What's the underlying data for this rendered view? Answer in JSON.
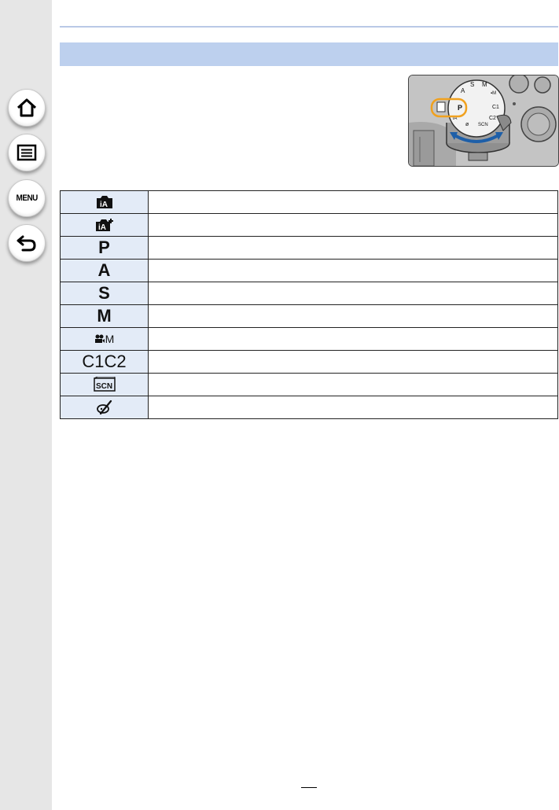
{
  "sidebar": {
    "buttons": [
      {
        "name": "home",
        "icon": "home-icon"
      },
      {
        "name": "contents",
        "icon": "list-icon"
      },
      {
        "name": "menu",
        "icon": "menu-icon",
        "label": "MENU"
      },
      {
        "name": "back",
        "icon": "return-arrow-icon"
      }
    ]
  },
  "colors": {
    "sidebar_bg": "#e6e6e6",
    "section_bar": "#bdd0ee",
    "icon_cell_bg": "#e3ebf7",
    "dial_highlight": "#f0a11f",
    "rotation_arrow": "#1e5fa8"
  },
  "illustration": {
    "description_icon": "camera-mode-dial-icon",
    "dial_labels": [
      "P",
      "A",
      "S",
      "M",
      "C1",
      "C2"
    ]
  },
  "mode_table": {
    "rows": [
      {
        "icon": "intelligent-auto-icon",
        "glyph": "iA"
      },
      {
        "icon": "intelligent-auto-plus-icon",
        "glyph": "iA+"
      },
      {
        "icon": "program-ae-icon",
        "glyph": "P"
      },
      {
        "icon": "aperture-priority-icon",
        "glyph": "A"
      },
      {
        "icon": "shutter-priority-icon",
        "glyph": "S"
      },
      {
        "icon": "manual-exposure-icon",
        "glyph": "M"
      },
      {
        "icon": "creative-video-icon",
        "glyph": "M"
      },
      {
        "icon": "custom-mode-icon",
        "glyph": "C1C2"
      },
      {
        "icon": "scene-guide-icon",
        "glyph": "SCN"
      },
      {
        "icon": "creative-control-icon",
        "glyph": ""
      }
    ]
  }
}
